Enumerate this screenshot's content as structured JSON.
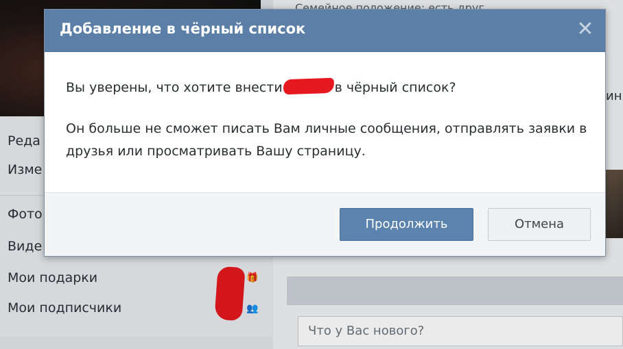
{
  "background": {
    "top_text": "Семейное положение: есть друг",
    "menu": [
      "Реда",
      "Изме",
      "Фото",
      "Виде",
      "Мои подарки",
      "Мои подписчики"
    ],
    "right_strip_text": "ин",
    "status_placeholder": "Что у Вас нового?",
    "icons": [
      "gift-icon",
      "subscribers-icon"
    ]
  },
  "dialog": {
    "title": "Добавление в чёрный список",
    "close_icon": "close-icon",
    "question_before": "Вы уверены, что хотите внести",
    "question_after": "в чёрный список?",
    "explanation": "Он больше не сможет писать Вам личные сообщения, отправлять заявки в друзья или просматривать Вашу страницу.",
    "continue_label": "Продолжить",
    "cancel_label": "Отмена"
  },
  "colors": {
    "header": "#5b7fa6",
    "primary_button": "#5c83ad",
    "redaction": "#e4181e"
  }
}
